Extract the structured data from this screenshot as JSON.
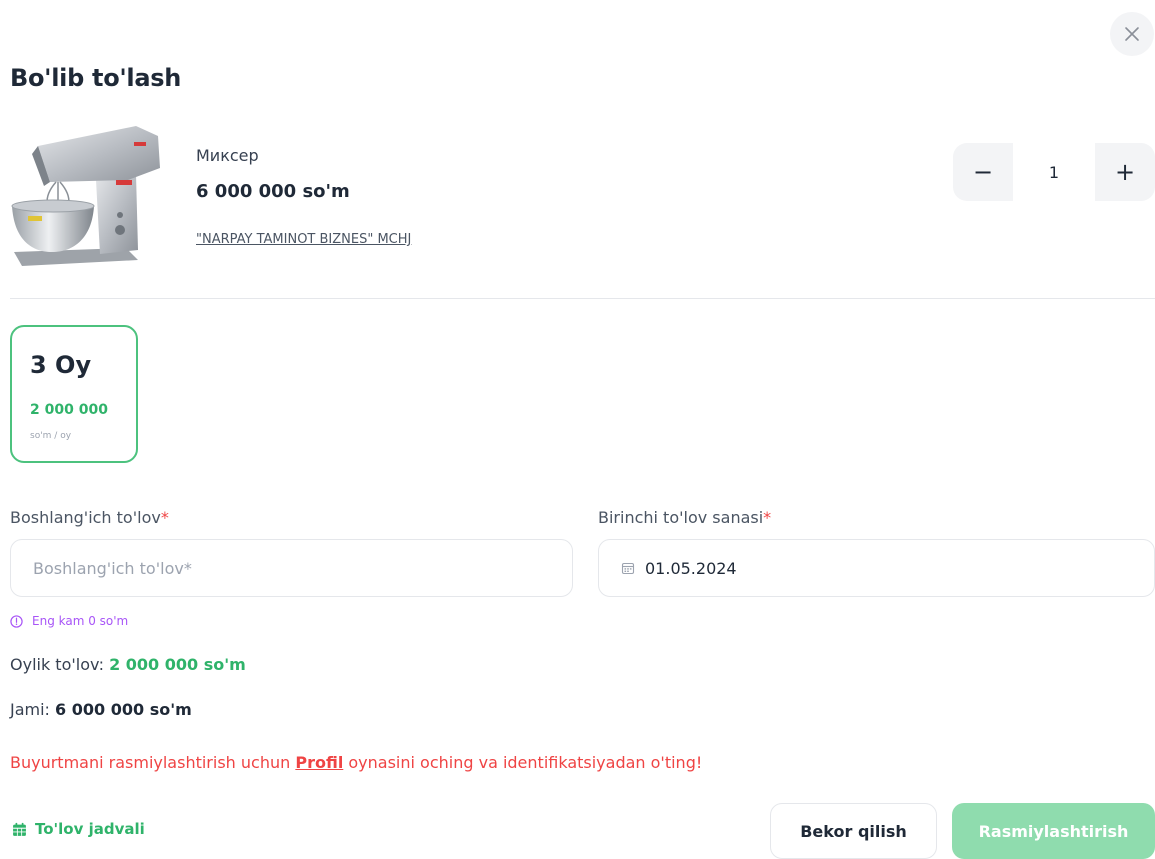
{
  "modal": {
    "title": "Bo'lib to'lash",
    "close_icon": "close-icon"
  },
  "product": {
    "name": "Миксер",
    "price": "6 000 000 so'm",
    "seller": "\"NARPAY TAMINOT BIZNES\" MCHJ",
    "image": "stand-mixer-image"
  },
  "quantity": {
    "minus_label": "−",
    "value": "1",
    "plus_label": "+"
  },
  "plans": [
    {
      "title": "3 Oy",
      "amount": "2 000 000",
      "unit": "so'm / oy",
      "selected": true
    }
  ],
  "form": {
    "down_payment": {
      "label": "Boshlang'ich to'lov",
      "required_mark": "*",
      "placeholder": "Boshlang'ich to'lov*",
      "value": "",
      "hint": "Eng kam 0 so'm",
      "hint_icon": "info-icon"
    },
    "first_payment_date": {
      "label": "Birinchi to'lov sanasi",
      "required_mark": "*",
      "value": "01.05.2024",
      "icon": "calendar-icon"
    }
  },
  "summary": {
    "monthly_label": "Oylik to'lov:",
    "monthly_value": "2 000 000 so'm",
    "total_label": "Jami:",
    "total_value": "6 000 000 so'm"
  },
  "warning": {
    "before": "Buyurtmani rasmiylashtirish uchun ",
    "link": "Profil",
    "after": " oynasini oching va identifikatsiyadan o'ting!"
  },
  "footer": {
    "schedule_label": "To'lov jadvali",
    "schedule_icon": "calendar-icon",
    "cancel_label": "Bekor qilish",
    "submit_label": "Rasmiylashtirish"
  },
  "colors": {
    "accent_green": "#2fb36a",
    "submit_disabled": "#8fdcae",
    "error_red": "#ef4444",
    "hint_purple": "#a855f7"
  }
}
